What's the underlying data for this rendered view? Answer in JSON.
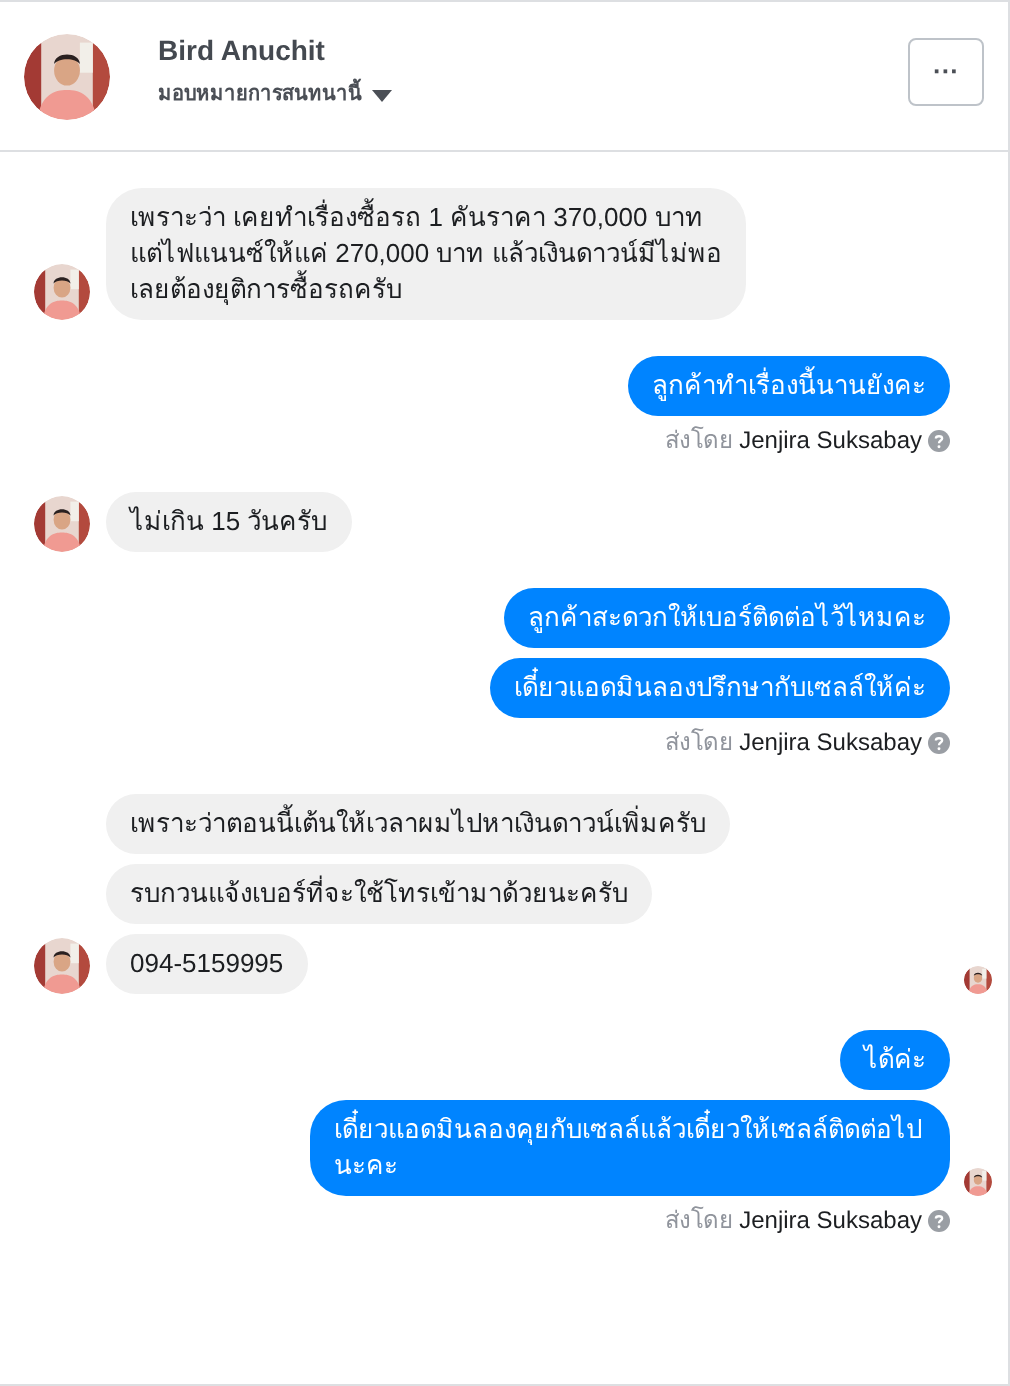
{
  "header": {
    "name": "Bird Anuchit",
    "assign_label": "มอบหมายการสนทนานี้",
    "more_button": "···"
  },
  "groups": [
    {
      "kind": "incoming",
      "messages": [
        {
          "text": "เพราะว่า เคยทำเรื่องซื้อรถ 1 คันราคา 370,000 บาท แต่ไฟแนนซ์ให้แค่ 270,000 บาท แล้วเงินดาวน์มีไม่พอเลยต้องยุติการซื้อรถครับ",
          "seen": false
        }
      ]
    },
    {
      "kind": "outgoing",
      "messages": [
        {
          "text": "ลูกค้าทำเรื่องนี้นานยังคะ",
          "seen": false
        }
      ],
      "sent_by": {
        "label": "ส่งโดย",
        "name": "Jenjira Suksabay"
      }
    },
    {
      "kind": "incoming",
      "messages": [
        {
          "text": "ไม่เกิน 15 วันครับ",
          "seen": false
        }
      ]
    },
    {
      "kind": "outgoing",
      "messages": [
        {
          "text": "ลูกค้าสะดวกให้เบอร์ติดต่อไว้ไหมคะ",
          "seen": false
        },
        {
          "text": "เดี๋ยวแอดมินลองปรึกษากับเซลล์ให้ค่ะ",
          "seen": false
        }
      ],
      "sent_by": {
        "label": "ส่งโดย",
        "name": "Jenjira Suksabay"
      }
    },
    {
      "kind": "incoming",
      "messages": [
        {
          "text": "เพราะว่าตอนนี้เต้นให้เวลาผมไปหาเงินดาวน์เพิ่มครับ",
          "seen": false
        },
        {
          "text": "รบกวนแจ้งเบอร์ที่จะใช้โทรเข้ามาด้วยนะครับ",
          "seen": false
        },
        {
          "text": "094-5159995",
          "seen": true
        }
      ]
    },
    {
      "kind": "outgoing",
      "messages": [
        {
          "text": "ได้ค่ะ",
          "seen": false
        },
        {
          "text": "เดี๋ยวแอดมินลองคุยกับเซลล์แล้วเดี๋ยวให้เซลล์ติดต่อไปนะคะ",
          "seen": true
        }
      ],
      "sent_by": {
        "label": "ส่งโดย",
        "name": "Jenjira Suksabay"
      }
    }
  ]
}
